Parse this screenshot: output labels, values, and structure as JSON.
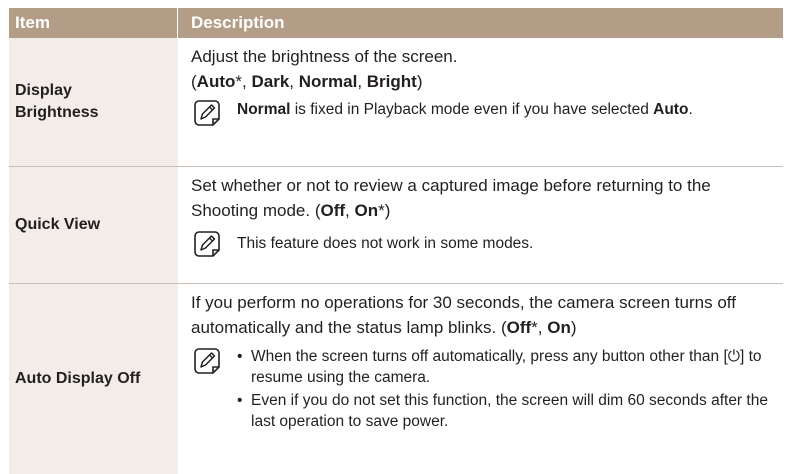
{
  "header": {
    "item": "Item",
    "description": "Description"
  },
  "rows": [
    {
      "item_line1": "Display",
      "item_line2": "Brightness",
      "desc_text": "Adjust the brightness of the screen.",
      "options": {
        "open": "(",
        "o1": "Auto",
        "star": "*",
        "sep1": ", ",
        "o2": "Dark",
        "sep2": ", ",
        "o3": "Normal",
        "sep3": ", ",
        "o4": "Bright",
        "close": ")"
      },
      "note": {
        "b1": "Normal",
        "text": " is fixed in Playback mode even if you have selected ",
        "b2": "Auto",
        "end": "."
      }
    },
    {
      "item": "Quick View",
      "desc_text": "Set whether or not to review a captured image before returning to the Shooting mode. ",
      "options": {
        "open": "(",
        "o1": "Off",
        "sep1": ", ",
        "o2": "On",
        "star": "*",
        "close": ")"
      },
      "note": {
        "text": "This feature does not work in some modes."
      }
    },
    {
      "item": "Auto Display Off",
      "desc_text": "If you perform no operations for 30 seconds, the camera screen turns off automatically and the status lamp blinks. ",
      "options": {
        "open": "(",
        "o1": "Off",
        "star": "*",
        "sep1": ", ",
        "o2": "On",
        "close": ")"
      },
      "note": {
        "bullet1_a": "When the screen turns off automatically, press any button other than [",
        "bullet1_power": "⏻",
        "bullet1_b": "] to resume using the camera.",
        "bullet2": "Even if you do not set this function, the screen will dim 60 seconds after the last operation to save power."
      }
    }
  ],
  "icons": {
    "note": "note-pencil-icon",
    "power": "power-icon"
  },
  "colors": {
    "header_bg": "#b39d86",
    "item_bg": "#f2ede8",
    "divider": "#c8c0b6"
  }
}
